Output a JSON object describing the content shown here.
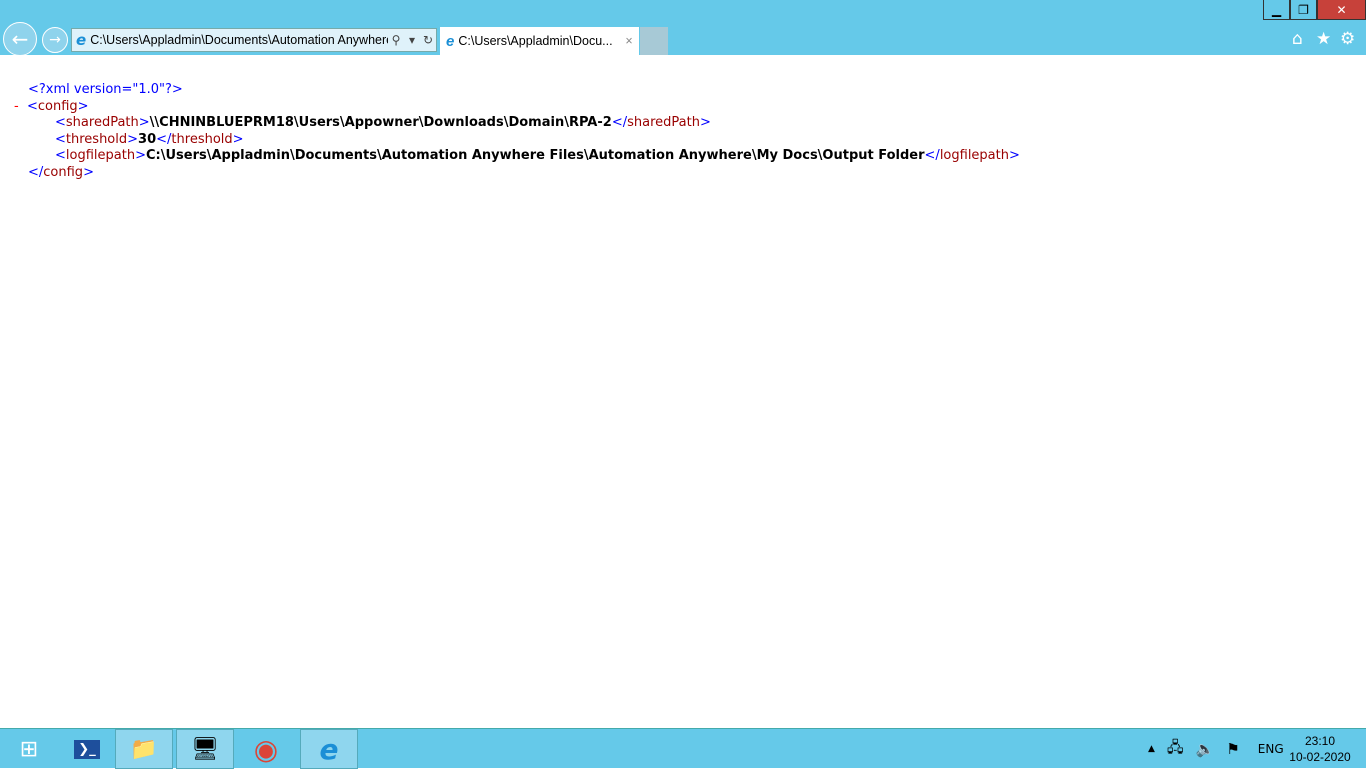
{
  "window": {
    "minimize": "▁",
    "maximize": "❐",
    "close": "✕"
  },
  "nav": {
    "back": "←",
    "forward": "→"
  },
  "address": {
    "value": "C:\\Users\\Appladmin\\Documents\\Automation Anywhere Files\\Automation Anywhere\\My Docs\\Output Folder",
    "search_icon": "⚲",
    "dropdown_icon": "▾",
    "refresh_icon": "↻"
  },
  "tab": {
    "title": "C:\\Users\\Appladmin\\Docu...",
    "close": "×"
  },
  "toolbar": {
    "home": "⌂",
    "favorites": "★",
    "tools": "⚙"
  },
  "xml": {
    "decl": "<?xml version=\"1.0\"?>",
    "collapse": "-",
    "root_tag": "config",
    "elements": [
      {
        "tag": "sharedPath",
        "value": "\\\\CHNINBLUEPRM18\\Users\\Appowner\\Downloads\\Domain\\RPA-2"
      },
      {
        "tag": "threshold",
        "value": "30"
      },
      {
        "tag": "logfilepath",
        "value": "C:\\Users\\Appladmin\\Documents\\Automation Anywhere Files\\Automation Anywhere\\My Docs\\Output Folder"
      }
    ],
    "lt": "<",
    "gt": ">",
    "lts": "</"
  },
  "taskbar": {
    "start": "⊞",
    "powershell": "❯_",
    "explorer": "📁",
    "server_manager": "🖥",
    "chrome": "◉",
    "ie": "e"
  },
  "tray": {
    "expand": "▲",
    "network": "🖧",
    "volume": "🔈",
    "flag": "⚑",
    "lang": "ENG"
  },
  "clock": {
    "time": "23:10",
    "date": "10-02-2020"
  }
}
